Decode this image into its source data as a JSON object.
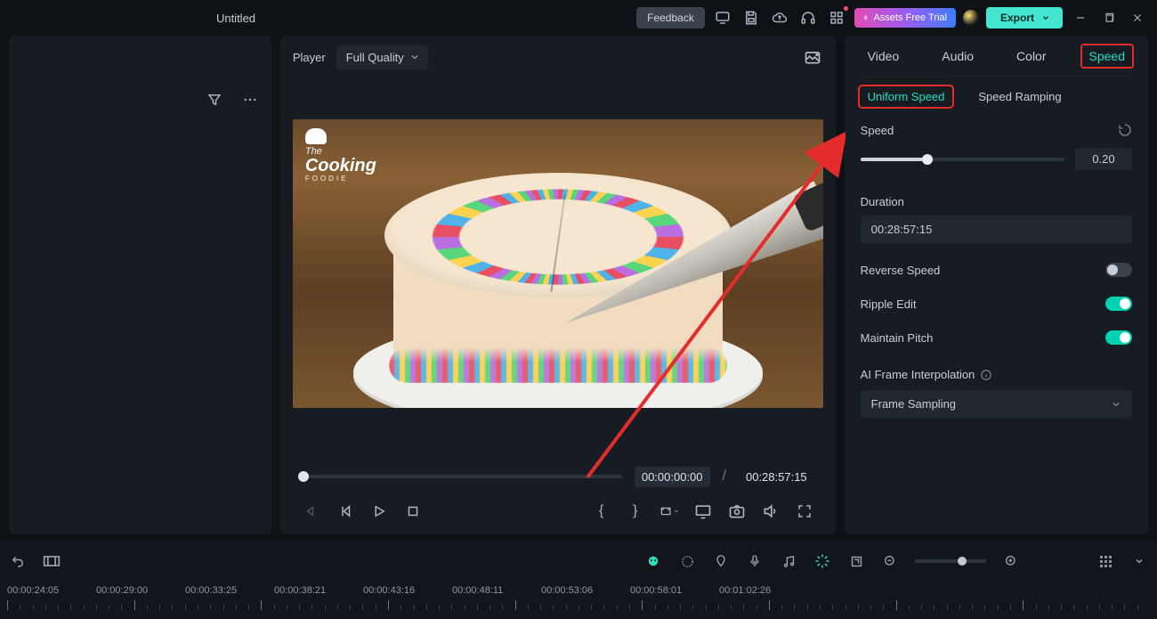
{
  "titlebar": {
    "doc_title": "Untitled",
    "feedback": "Feedback",
    "assets_trial": "Assets Free Trial",
    "export": "Export"
  },
  "player": {
    "label": "Player",
    "quality": "Full Quality",
    "current_time": "00:00:00:00",
    "total_time": "00:28:57:15",
    "logo": {
      "line1": "The",
      "line2": "Cooking",
      "line3": "FOODIE"
    }
  },
  "tabs": {
    "video": "Video",
    "audio": "Audio",
    "color": "Color",
    "speed": "Speed"
  },
  "subtabs": {
    "uniform": "Uniform Speed",
    "ramping": "Speed Ramping"
  },
  "speed": {
    "label": "Speed",
    "value": "0.20",
    "slider_pct": 33,
    "duration_label": "Duration",
    "duration": "00:28:57:15",
    "reverse": "Reverse Speed",
    "ripple": "Ripple Edit",
    "pitch": "Maintain Pitch",
    "ai": "AI Frame Interpolation",
    "ai_mode": "Frame Sampling",
    "reverse_on": false,
    "ripple_on": true,
    "pitch_on": true
  },
  "timeline": {
    "labels": [
      "00:00:24:05",
      "00:00:29:00",
      "00:00:33:25",
      "00:00:38:21",
      "00:00:43:16",
      "00:00:48:11",
      "00:00:53:06",
      "00:00:58:01",
      "00:01:02:26"
    ]
  }
}
